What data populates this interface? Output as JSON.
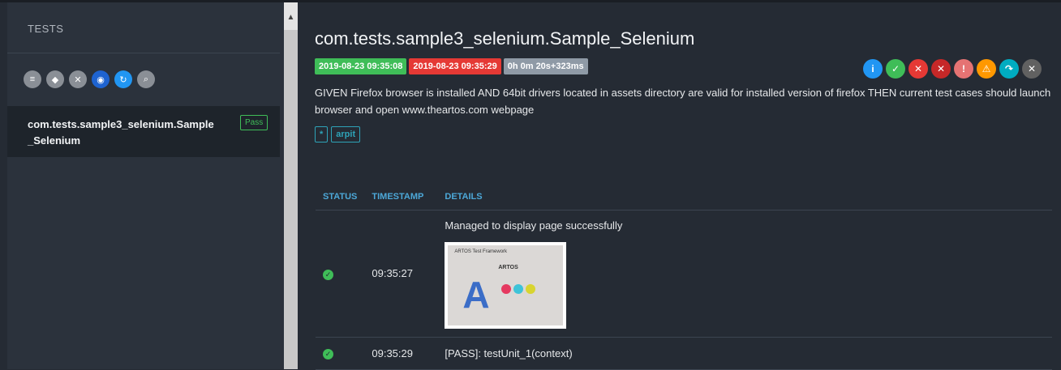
{
  "sidebar": {
    "header": "TESTS",
    "filters": [
      {
        "name": "all-filter-icon",
        "glyph": "≡",
        "color": "#8a8f96"
      },
      {
        "name": "tag-filter-icon",
        "glyph": "◆",
        "color": "#8a8f96"
      },
      {
        "name": "fail-filter-icon",
        "glyph": "✕",
        "color": "#8a8f96"
      },
      {
        "name": "fingerprint-filter-icon",
        "glyph": "◉",
        "color": "#1e63d0"
      },
      {
        "name": "refresh-filter-icon",
        "glyph": "↻",
        "color": "#2196f3"
      },
      {
        "name": "search-filter-icon",
        "glyph": "⌕",
        "color": "#8a8f96"
      }
    ],
    "test_item": {
      "name": "com.tests.sample3_selenium.Sample_Selenium",
      "status": "Pass"
    }
  },
  "main": {
    "title": "com.tests.sample3_selenium.Sample_Selenium",
    "start_time": "2019-08-23 09:35:08",
    "end_time": "2019-08-23 09:35:29",
    "duration": "0h 0m 20s+323ms",
    "status_icons": [
      {
        "name": "info-icon",
        "glyph": "i",
        "color": "#2196f3"
      },
      {
        "name": "pass-icon",
        "glyph": "✓",
        "color": "#3fbd58"
      },
      {
        "name": "fail-icon",
        "glyph": "✕",
        "color": "#e53935"
      },
      {
        "name": "fatal-icon",
        "glyph": "✕",
        "color": "#c62828"
      },
      {
        "name": "error-icon",
        "glyph": "!",
        "color": "#e57373"
      },
      {
        "name": "warning-icon",
        "glyph": "⚠",
        "color": "#ff9800"
      },
      {
        "name": "skip-icon",
        "glyph": "↷",
        "color": "#00acc1"
      },
      {
        "name": "close-icon",
        "glyph": "✕",
        "color": "#616161"
      }
    ],
    "description": "GIVEN Firefox browser is installed AND 64bit drivers located in assets directory are valid for installed version of firefox THEN current test cases should launch browser and open www.theartos.com webpage",
    "tags": [
      "*",
      "arpit"
    ],
    "table": {
      "headers": [
        "STATUS",
        "TIMESTAMP",
        "DETAILS"
      ],
      "rows": [
        {
          "timestamp": "09:35:27",
          "details": "Managed to display page successfully",
          "has_screenshot": true
        },
        {
          "timestamp": "09:35:29",
          "details": "[PASS]: testUnit_1(context)",
          "has_screenshot": false
        }
      ]
    },
    "screenshot_text": {
      "heading": "ARTOS Test Framework",
      "brand": "ARTOS"
    }
  }
}
